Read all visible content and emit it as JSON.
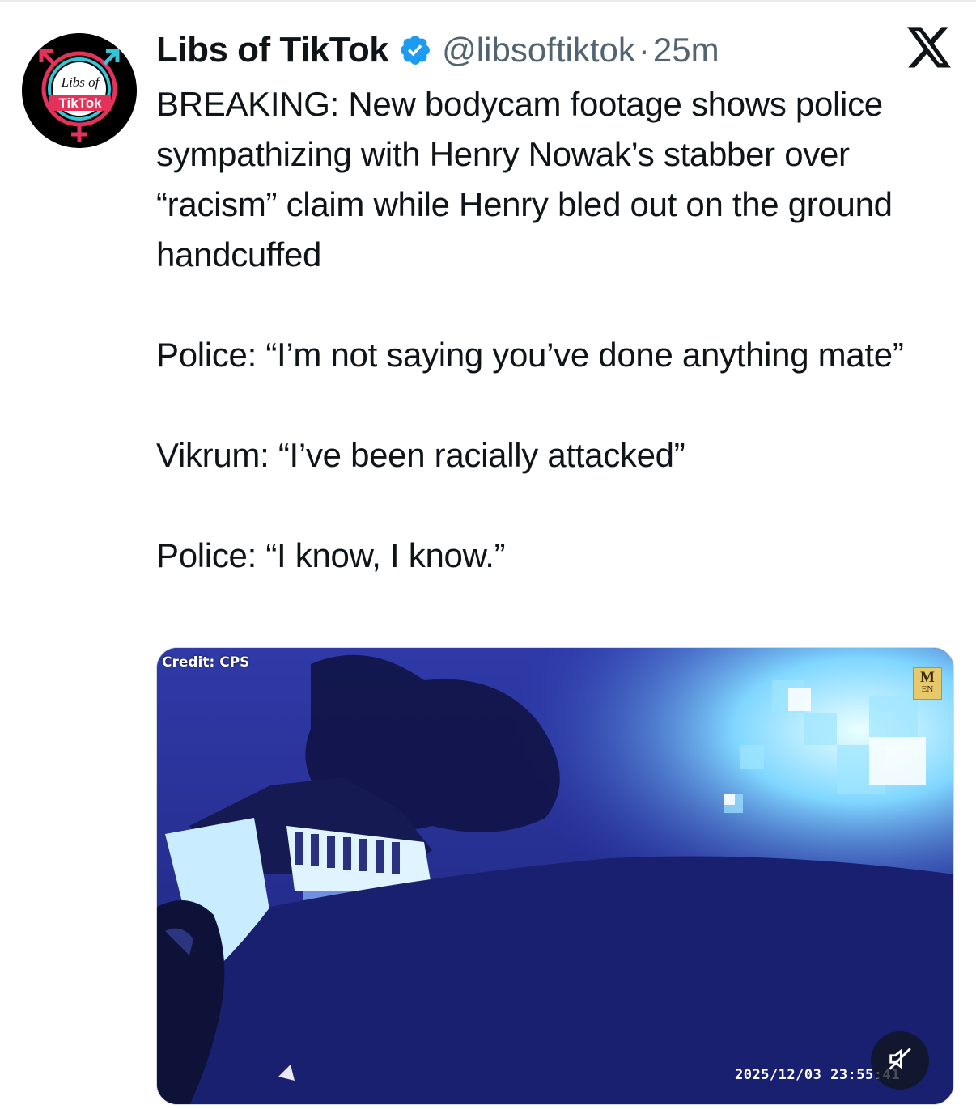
{
  "tweet": {
    "display_name": "Libs of TikTok",
    "handle": "@libsoftiktok",
    "separator": "·",
    "time": "25m",
    "avatar_text_line1": "Libs of",
    "avatar_text_line2": "TikTok",
    "paragraphs": [
      "BREAKING: New bodycam footage shows police sympathizing with Henry Nowak’s stabber over “racism” claim while Henry bled out on the ground handcuffed",
      "Police: “I’m not saying you’ve done anything mate”",
      "Vikrum: “I’ve been racially attacked”",
      "Police: “I know, I know.”"
    ]
  },
  "media": {
    "credit": "Credit: CPS",
    "badge_top": "M",
    "badge_bottom": "EN",
    "timestamp": "2025/12/03  23:55:41",
    "mute_icon": "speaker-muted-icon"
  },
  "icons": {
    "verified": "verified-badge-icon",
    "brand": "x-logo-icon"
  },
  "colors": {
    "verified_blue": "#1d9bf0",
    "secondary_text": "#536471",
    "primary_text": "#0f1419"
  }
}
